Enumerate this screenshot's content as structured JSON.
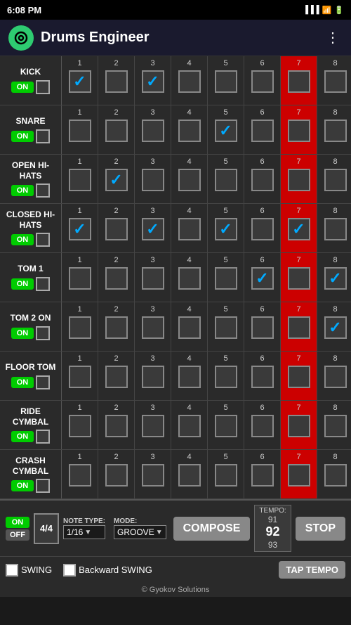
{
  "statusBar": {
    "time": "6:08 PM"
  },
  "header": {
    "title": "Drums Engineer",
    "menu": "⋮"
  },
  "drums": [
    {
      "name": "KICK",
      "id": "kick",
      "onState": "ON",
      "steps": [
        true,
        false,
        true,
        false,
        false,
        false,
        false,
        false
      ]
    },
    {
      "name": "SNARE",
      "id": "snare",
      "onState": "ON",
      "steps": [
        false,
        false,
        false,
        false,
        true,
        false,
        false,
        false
      ]
    },
    {
      "name": "OPEN HI-HATS",
      "id": "open-hihats",
      "onState": "ON",
      "steps": [
        false,
        true,
        false,
        false,
        false,
        false,
        false,
        false
      ]
    },
    {
      "name": "CLOSED HI-HATS",
      "id": "closed-hihats",
      "onState": "ON",
      "steps": [
        true,
        false,
        true,
        false,
        true,
        false,
        true,
        false
      ]
    },
    {
      "name": "TOM 1",
      "id": "tom1",
      "onState": "ON",
      "steps": [
        false,
        false,
        false,
        false,
        false,
        true,
        false,
        true
      ]
    },
    {
      "name": "TOM 2 ON",
      "id": "tom2",
      "onState": "ON",
      "steps": [
        false,
        false,
        false,
        false,
        false,
        false,
        false,
        true
      ]
    },
    {
      "name": "FLOOR TOM",
      "id": "floor-tom",
      "onState": "ON",
      "steps": [
        false,
        false,
        false,
        false,
        false,
        false,
        false,
        false
      ]
    },
    {
      "name": "RIDE CYMBAL",
      "id": "ride-cymbal",
      "onState": "ON",
      "steps": [
        false,
        false,
        false,
        false,
        false,
        false,
        false,
        false
      ]
    },
    {
      "name": "CRASH CYMBAL",
      "id": "crash-cymbal",
      "onState": "ON",
      "steps": [
        false,
        false,
        false,
        false,
        false,
        false,
        false,
        false
      ]
    }
  ],
  "stepNumbers": [
    1,
    2,
    3,
    4,
    5,
    6,
    7,
    8
  ],
  "highlightStep": 7,
  "bottomControls": {
    "onLabel": "ON",
    "offLabel": "OFF",
    "timeSig": "4/4",
    "noteTypeLabel": "NOTE TYPE:",
    "noteType": "1/16",
    "modeLabel": "MODE:",
    "mode": "GROOVE",
    "composeLabel": "COMPOSE",
    "tempoLabel": "TEMPO:",
    "tempoPrev": "91",
    "tempoCurrent": "92",
    "tempoNext": "93",
    "stopLabel": "STOP"
  },
  "footer": {
    "swingLabel": "SWING",
    "backwardSwingLabel": "Backward SWING",
    "tapTempoLabel": "TAP TEMPO",
    "copyright": "© Gyokov Solutions"
  }
}
